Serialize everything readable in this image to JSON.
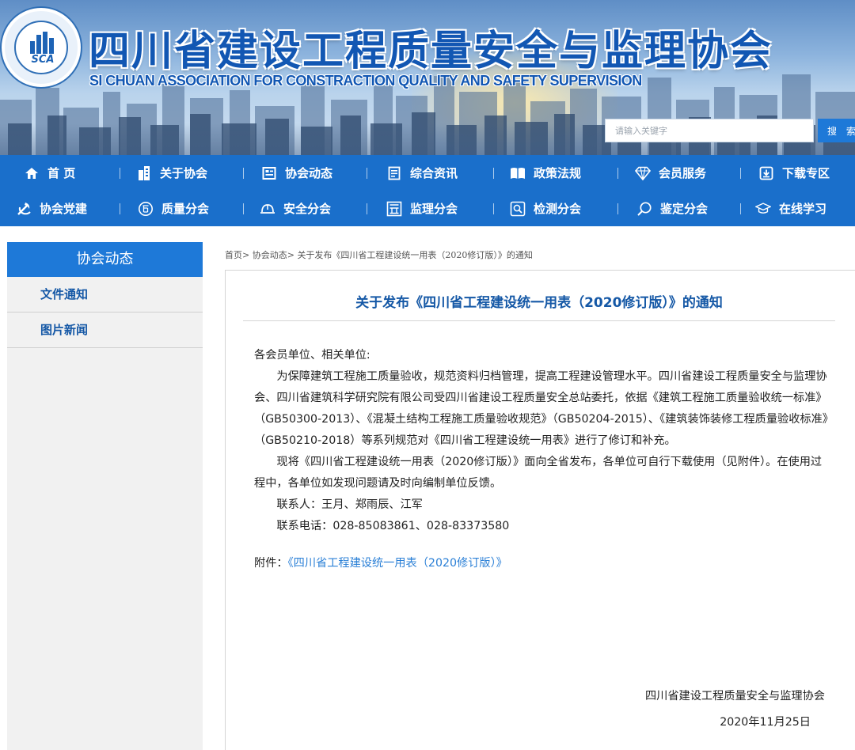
{
  "header": {
    "logo_text": "SCA",
    "title": "四川省建设工程质量安全与监理协会",
    "subtitle": "SI CHUAN ASSOCIATION FOR CONSTRACTION QUALITY AND SAFETY SUPERVISION",
    "search": {
      "placeholder": "请输入关键字",
      "value": "",
      "button_label": "搜 索"
    }
  },
  "nav": {
    "row1": [
      {
        "label": "首 页",
        "icon": "home-icon"
      },
      {
        "label": "关于协会",
        "icon": "building-icon"
      },
      {
        "label": "协会动态",
        "icon": "news-icon"
      },
      {
        "label": "综合资讯",
        "icon": "document-icon"
      },
      {
        "label": "政策法规",
        "icon": "policy-book-icon"
      },
      {
        "label": "会员服务",
        "icon": "diamond-icon"
      },
      {
        "label": "下载专区",
        "icon": "download-icon"
      }
    ],
    "row2": [
      {
        "label": "协会党建",
        "icon": "party-emblem-icon"
      },
      {
        "label": "质量分会",
        "icon": "quality-seal-icon"
      },
      {
        "label": "安全分会",
        "icon": "hard-hat-icon"
      },
      {
        "label": "监理分会",
        "icon": "supervision-icon"
      },
      {
        "label": "检测分会",
        "icon": "inspection-icon"
      },
      {
        "label": "鉴定分会",
        "icon": "magnifier-icon"
      },
      {
        "label": "在线学习",
        "icon": "graduation-cap-icon"
      }
    ]
  },
  "sidebar": {
    "title": "协会动态",
    "items": [
      {
        "label": "文件通知"
      },
      {
        "label": "图片新闻"
      }
    ]
  },
  "breadcrumb": {
    "home": "首页",
    "section": "协会动态",
    "current": "关于发布《四川省工程建设统一用表（2020修订版）》的通知",
    "separator": ">"
  },
  "article": {
    "title": "关于发布《四川省工程建设统一用表（2020修订版）》的通知",
    "greeting": "各会员单位、相关单位:",
    "paragraph1": "为保障建筑工程施工质量验收，规范资料归档管理，提高工程建设管理水平。四川省建设工程质量安全与监理协会、四川省建筑科学研究院有限公司受四川省建设工程质量安全总站委托，依据《建筑工程施工质量验收统一标准》（GB50300-2013）、《混凝土结构工程施工质量验收规范》（GB50204-2015）、《建筑装饰装修工程质量验收标准》（GB50210-2018）等系列规范对《四川省工程建设统一用表》进行了修订和补充。",
    "paragraph2": "现将《四川省工程建设统一用表（2020修订版）》面向全省发布，各单位可自行下载使用（见附件）。在使用过程中，各单位如发现问题请及时向编制单位反馈。",
    "contact_people": "联系人：王月、郑雨辰、江军",
    "contact_phone": "联系电话：028-85083861、028-83373580",
    "attachment_label": "附件：",
    "attachment_link": "《四川省工程建设统一用表（2020修订版）》",
    "signature_org": "四川省建设工程质量安全与监理协会",
    "signature_date": "2020年11月25日"
  },
  "colors": {
    "nav_bg": "#1a6fcb",
    "accent": "#1e79d8",
    "title_blue": "#1558a6",
    "link_blue": "#2a7fd6"
  }
}
